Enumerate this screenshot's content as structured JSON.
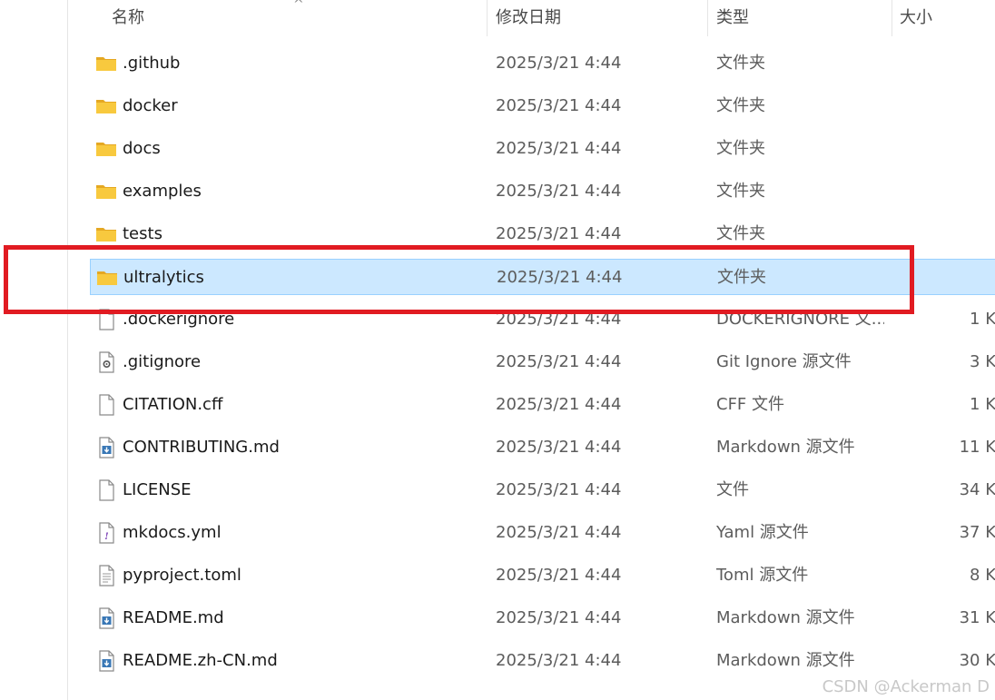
{
  "columns": {
    "name": "名称",
    "date": "修改日期",
    "type": "类型",
    "size": "大小"
  },
  "sort_indicator": "^",
  "rows": [
    {
      "name": ".github",
      "date": "2025/3/21 4:44",
      "type": "文件夹",
      "size": "",
      "icon": "folder-icon"
    },
    {
      "name": "docker",
      "date": "2025/3/21 4:44",
      "type": "文件夹",
      "size": "",
      "icon": "folder-icon"
    },
    {
      "name": "docs",
      "date": "2025/3/21 4:44",
      "type": "文件夹",
      "size": "",
      "icon": "folder-icon"
    },
    {
      "name": "examples",
      "date": "2025/3/21 4:44",
      "type": "文件夹",
      "size": "",
      "icon": "folder-icon"
    },
    {
      "name": "tests",
      "date": "2025/3/21 4:44",
      "type": "文件夹",
      "size": "",
      "icon": "folder-icon"
    },
    {
      "name": "ultralytics",
      "date": "2025/3/21 4:44",
      "type": "文件夹",
      "size": "",
      "icon": "folder-icon",
      "selected": true
    },
    {
      "name": ".dockerignore",
      "date": "2025/3/21 4:44",
      "type": "DOCKERIGNORE 文...",
      "size": "1 K",
      "icon": "file-icon"
    },
    {
      "name": ".gitignore",
      "date": "2025/3/21 4:44",
      "type": "Git Ignore 源文件",
      "size": "3 K",
      "icon": "config-file-icon"
    },
    {
      "name": "CITATION.cff",
      "date": "2025/3/21 4:44",
      "type": "CFF 文件",
      "size": "1 K",
      "icon": "file-icon"
    },
    {
      "name": "CONTRIBUTING.md",
      "date": "2025/3/21 4:44",
      "type": "Markdown 源文件",
      "size": "11 K",
      "icon": "markdown-file-icon"
    },
    {
      "name": "LICENSE",
      "date": "2025/3/21 4:44",
      "type": "文件",
      "size": "34 K",
      "icon": "file-icon"
    },
    {
      "name": "mkdocs.yml",
      "date": "2025/3/21 4:44",
      "type": "Yaml 源文件",
      "size": "37 K",
      "icon": "yaml-file-icon"
    },
    {
      "name": "pyproject.toml",
      "date": "2025/3/21 4:44",
      "type": "Toml 源文件",
      "size": "8 K",
      "icon": "text-file-icon"
    },
    {
      "name": "README.md",
      "date": "2025/3/21 4:44",
      "type": "Markdown 源文件",
      "size": "31 K",
      "icon": "markdown-file-icon"
    },
    {
      "name": "README.zh-CN.md",
      "date": "2025/3/21 4:44",
      "type": "Markdown 源文件",
      "size": "30 K",
      "icon": "markdown-file-icon"
    }
  ],
  "watermark": "CSDN @Ackerman D",
  "colors": {
    "selection": "#cce8ff",
    "highlight": "#e11b22",
    "folder": "#f8c93e"
  }
}
